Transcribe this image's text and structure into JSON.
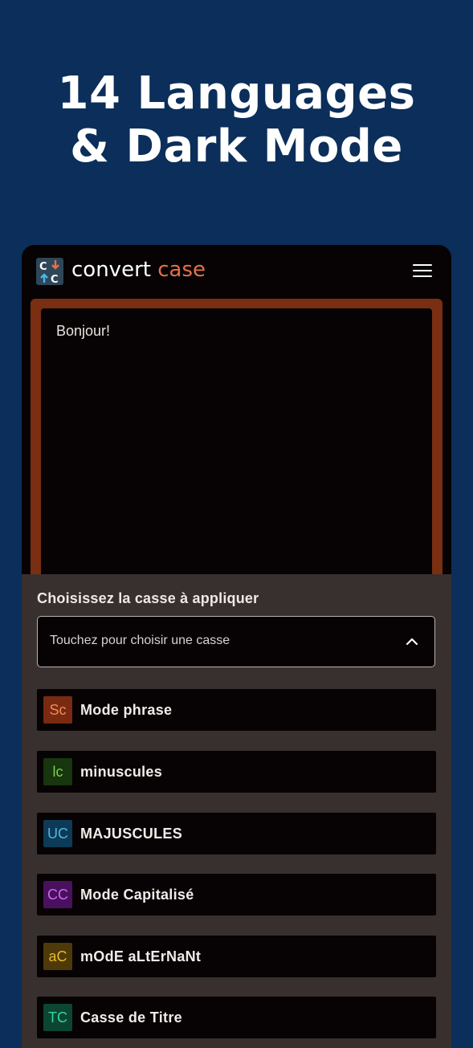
{
  "headline": {
    "line1": "14 Languages",
    "line2": "& Dark Mode"
  },
  "app": {
    "logo_word1": "convert",
    "logo_word2": "case",
    "accent_color": "#e3704a",
    "menu_icon": "hamburger-menu-icon"
  },
  "editor": {
    "text": "Bonjour!"
  },
  "sheet": {
    "title": "Choisissez la casse à appliquer",
    "select_placeholder": "Touchez pour choisir une casse",
    "select_icon": "chevron-up-icon",
    "options": [
      {
        "badge": "Sc",
        "label": "Mode phrase",
        "badge_bg": "#7a2a10",
        "badge_fg": "#f08a5a"
      },
      {
        "badge": "lc",
        "label": "minuscules",
        "badge_bg": "#17350e",
        "badge_fg": "#7bd349"
      },
      {
        "badge": "UC",
        "label": "MAJUSCULES",
        "badge_bg": "#0d3a55",
        "badge_fg": "#4bb7e8"
      },
      {
        "badge": "CC",
        "label": "Mode Capitalisé",
        "badge_bg": "#4a1060",
        "badge_fg": "#c96ae8"
      },
      {
        "badge": "aC",
        "label": "mOdE aLtErNaNt",
        "badge_bg": "#4d3a08",
        "badge_fg": "#e8b92e"
      },
      {
        "badge": "TC",
        "label": "Casse de Titre",
        "badge_bg": "#0c4633",
        "badge_fg": "#36d69a"
      }
    ]
  }
}
